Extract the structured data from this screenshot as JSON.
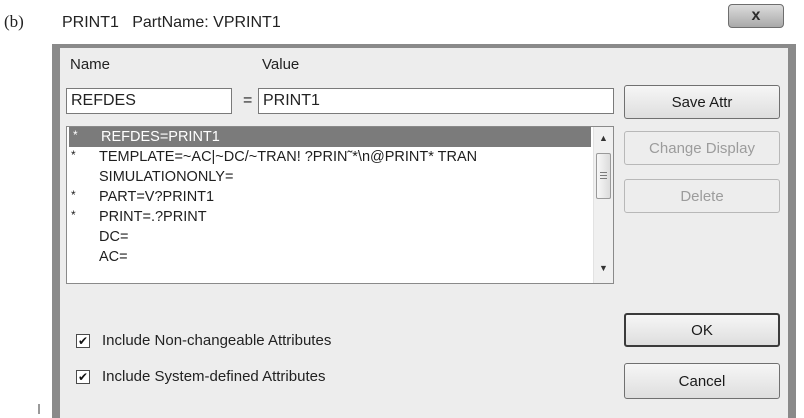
{
  "figure_label": "(b)",
  "window": {
    "title": "PRINT1   PartName: VPRINT1",
    "close_glyph": "x"
  },
  "form": {
    "name_label": "Name",
    "value_label": "Value",
    "name_value": "REFDES",
    "equals": "=",
    "value_value": "PRINT1"
  },
  "attributes": [
    {
      "mark": "*",
      "text": "REFDES=PRINT1",
      "selected": true
    },
    {
      "mark": "*",
      "text": "TEMPLATE=~AC|~DC/~TRAN! ?PRIN˜*\\n@PRINT* TRAN",
      "selected": false
    },
    {
      "mark": "",
      "text": "SIMULATIONONLY=",
      "selected": false
    },
    {
      "mark": "*",
      "text": "PART=V?PRINT1",
      "selected": false
    },
    {
      "mark": "*",
      "text": "PRINT=.?PRINT",
      "selected": false
    },
    {
      "mark": "",
      "text": "DC=",
      "selected": false
    },
    {
      "mark": "",
      "text": "AC=",
      "selected": false
    }
  ],
  "scrollbar": {
    "up_glyph": "▲",
    "down_glyph": "▼"
  },
  "buttons": {
    "save_attr": "Save Attr",
    "change_display": "Change Display",
    "delete": "Delete",
    "ok": "OK",
    "cancel": "Cancel"
  },
  "options": {
    "include_non_changeable": {
      "label": "Include Non-changeable Attributes",
      "checked": true
    },
    "include_system_defined": {
      "label": "Include System-defined Attributes",
      "checked": true
    }
  },
  "check_glyph": "✔"
}
